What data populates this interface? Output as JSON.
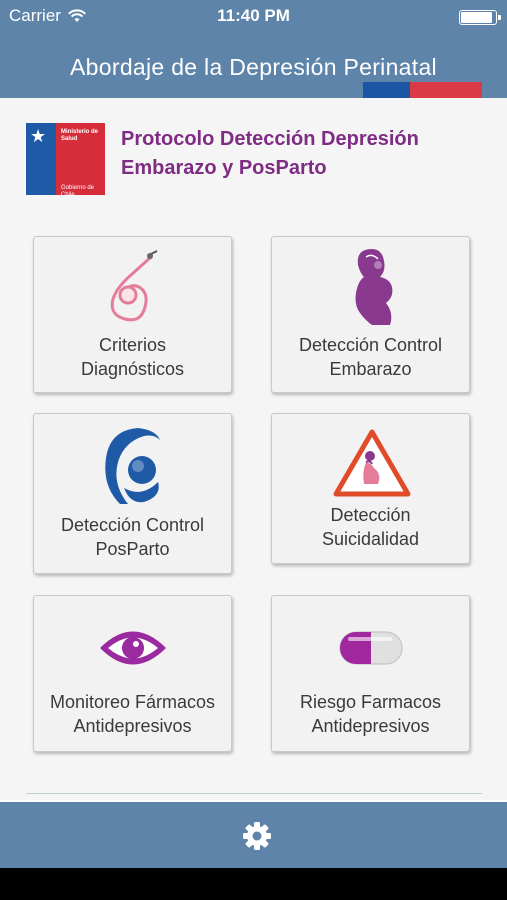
{
  "status_bar": {
    "carrier": "Carrier",
    "time": "11:40 PM",
    "battery_level": 0.95
  },
  "header": {
    "title": "Abordaje de la Depresión Perinatal"
  },
  "logo": {
    "line1": "Ministerio de Salud",
    "line2": "Gobierno de Chile"
  },
  "protocol_title": "Protocolo Detección Depresión Embarazo y PosParto",
  "menu": [
    {
      "line1": "Criterios",
      "line2": "Diagnósticos",
      "icon": "stethoscope-icon"
    },
    {
      "line1": "Detección Control",
      "line2": "Embarazo",
      "icon": "pregnant-woman-icon"
    },
    {
      "line1": "Detección Control",
      "line2": "PosParto",
      "icon": "mother-child-icon"
    },
    {
      "line1": "Detección",
      "line2": "Suicidalidad",
      "icon": "warning-pregnant-icon"
    },
    {
      "line1": "Monitoreo Fármacos",
      "line2": "Antidepresivos",
      "icon": "eye-icon"
    },
    {
      "line1": "Riesgo Farmacos",
      "line2": "Antidepresivos",
      "icon": "pill-icon"
    }
  ],
  "colors": {
    "nav": "#5e84aa",
    "accent": "#7f2c84",
    "icon_purple": "#9a2aa0",
    "flag_blue": "#1b56a4",
    "flag_red": "#d93a45"
  },
  "tab_bar": {
    "icon": "gear-icon"
  }
}
